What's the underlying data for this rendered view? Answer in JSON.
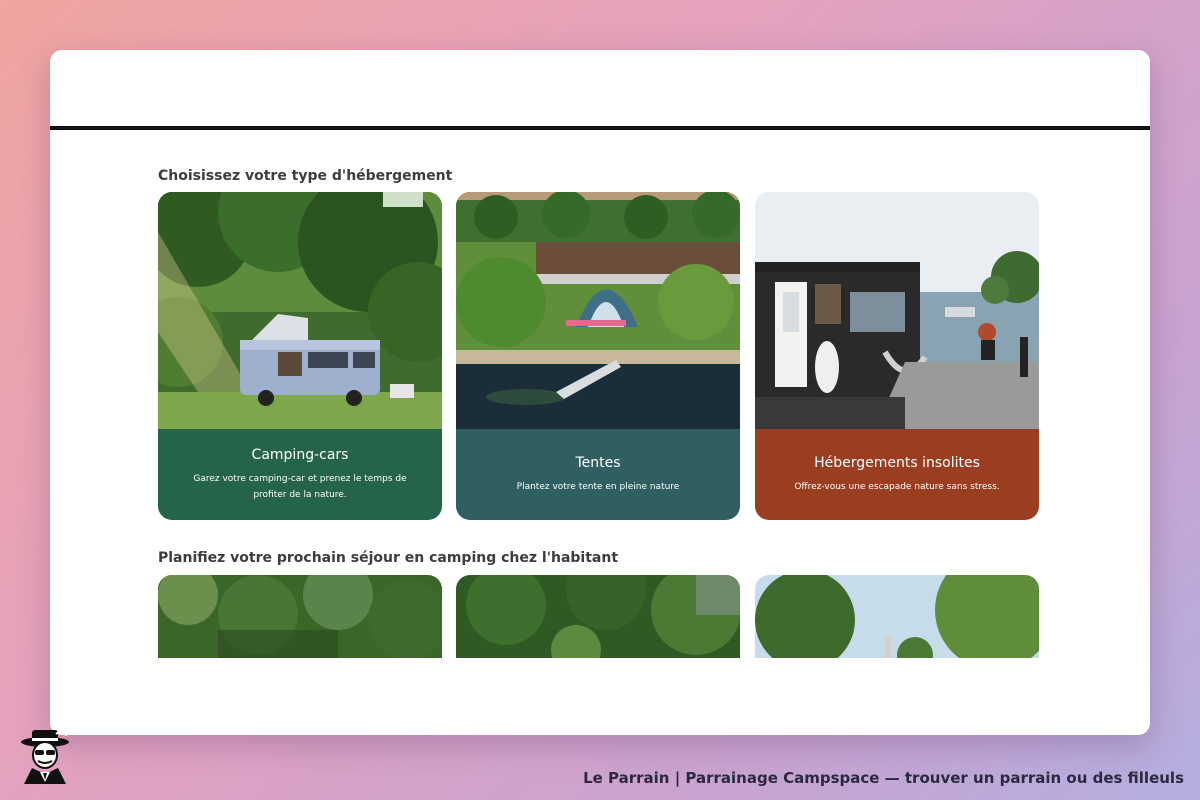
{
  "page": {
    "section_accommodation_title": "Choisissez votre type d'hébergement",
    "section_plan_title": "Planifiez votre prochain séjour en camping chez l'habitant"
  },
  "cards": [
    {
      "title": "Camping-cars",
      "description": "Garez votre camping-car et prenez le temps de profiter de la nature.",
      "color": "#25634a"
    },
    {
      "title": "Tentes",
      "description": "Plantez votre tente en pleine nature",
      "color": "#2f5f60"
    },
    {
      "title": "Hébergements insolites",
      "description": "Offrez-vous une escapade nature sans stress.",
      "color": "#9b3d20"
    }
  ],
  "footer": {
    "caption": "Le Parrain | Parrainage Campspace — trouver un parrain ou des filleuls",
    "logo_icon": "mafia-man-icon"
  }
}
